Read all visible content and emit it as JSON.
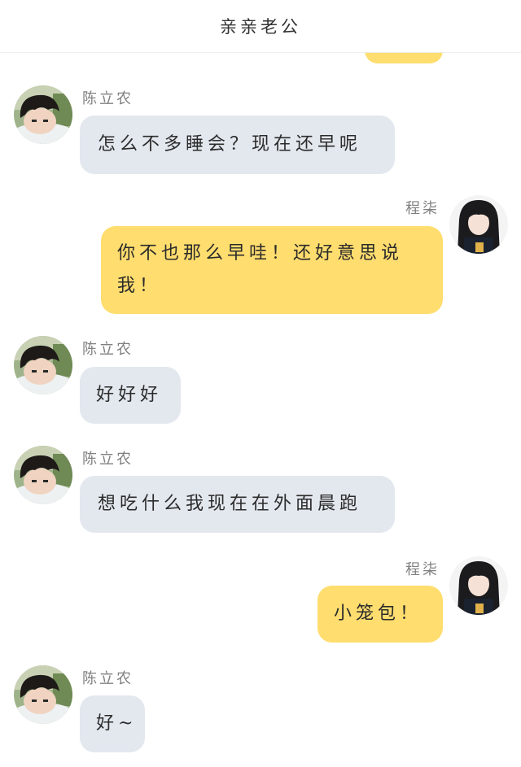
{
  "header": {
    "title": "亲亲老公"
  },
  "contacts": {
    "husband": {
      "name": "陈立农",
      "avatar_icon": "boy-avatar-icon"
    },
    "me": {
      "name": "程柒",
      "avatar_icon": "girl-avatar-icon"
    }
  },
  "colors": {
    "incoming_bubble": "#e3e8ef",
    "outgoing_bubble": "#ffdd6e",
    "name_text": "#808080"
  },
  "messages": [
    {
      "sender": "陈立农",
      "direction": "incoming",
      "text": "怎么不多睡会？现在还早呢"
    },
    {
      "sender": "程柒",
      "direction": "outgoing",
      "text": "你不也那么早哇！还好意思说我！"
    },
    {
      "sender": "陈立农",
      "direction": "incoming",
      "text": "好好好"
    },
    {
      "sender": "陈立农",
      "direction": "incoming",
      "text": "想吃什么我现在在外面晨跑"
    },
    {
      "sender": "程柒",
      "direction": "outgoing",
      "text": "小笼包！"
    },
    {
      "sender": "陈立农",
      "direction": "incoming",
      "text": "好~"
    }
  ]
}
